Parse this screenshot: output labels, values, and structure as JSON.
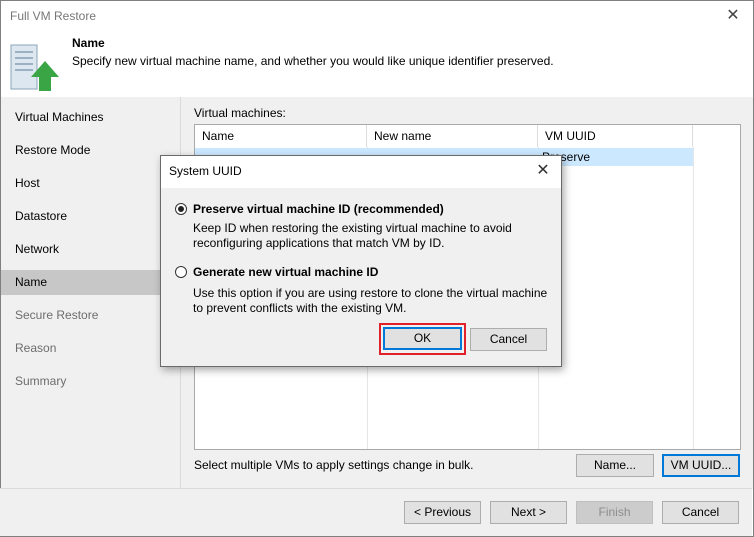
{
  "window": {
    "title": "Full VM Restore",
    "close_glyph": "✕"
  },
  "header": {
    "title": "Name",
    "description": "Specify new virtual machine name, and whether you would like unique identifier preserved.",
    "icon": "restore-arrow-icon"
  },
  "sidebar": {
    "items": [
      {
        "label": "Virtual Machines",
        "state": "normal"
      },
      {
        "label": "Restore Mode",
        "state": "normal"
      },
      {
        "label": "Host",
        "state": "normal"
      },
      {
        "label": "Datastore",
        "state": "normal"
      },
      {
        "label": "Network",
        "state": "normal"
      },
      {
        "label": "Name",
        "state": "active"
      },
      {
        "label": "Secure Restore",
        "state": "disabled"
      },
      {
        "label": "Reason",
        "state": "disabled"
      },
      {
        "label": "Summary",
        "state": "disabled"
      }
    ]
  },
  "main": {
    "vm_label": "Virtual machines:",
    "columns": [
      "Name",
      "New name",
      "VM UUID"
    ],
    "row": {
      "uuid": "Preserve"
    },
    "bulk_hint": "Select multiple VMs to apply settings change in bulk.",
    "name_button": "Name...",
    "uuid_button": "VM UUID..."
  },
  "footer": {
    "previous": "< Previous",
    "next": "Next >",
    "finish": "Finish",
    "cancel": "Cancel"
  },
  "dialog": {
    "title": "System UUID",
    "close_glyph": "✕",
    "option1_title": "Preserve virtual machine ID (recommended)",
    "option1_desc": "Keep ID when restoring the existing virtual machine to avoid reconfiguring applications that match VM by ID.",
    "option2_title": "Generate new virtual machine ID",
    "option2_desc": "Use this option if you are using restore to clone the virtual machine to prevent conflicts with the existing VM.",
    "ok": "OK",
    "cancel": "Cancel",
    "selected": "option1"
  },
  "colors": {
    "accent": "#0078d7",
    "highlight_box": "#e0202a",
    "selection_row": "#cce8ff",
    "icon_green": "#3aa544"
  }
}
